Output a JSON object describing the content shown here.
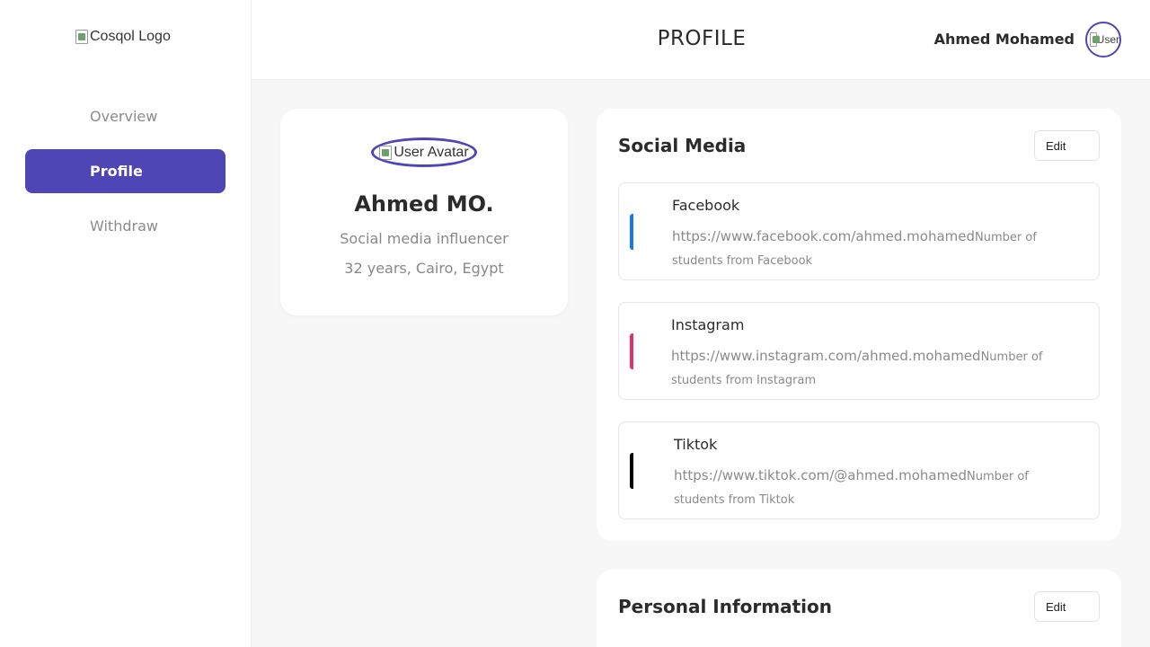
{
  "sidebar": {
    "logo_alt": "Cosqol Logo",
    "items": [
      {
        "label": "Overview",
        "active": false
      },
      {
        "label": "Profile",
        "active": true
      },
      {
        "label": "Withdraw",
        "active": false
      }
    ]
  },
  "header": {
    "title": "PROFILE",
    "user_name": "Ahmed Mohamed",
    "avatar_alt": "User"
  },
  "profile": {
    "avatar_alt": "User Avatar",
    "name": "Ahmed MO.",
    "role": "Social media influencer",
    "meta": "32 years, Cairo, Egypt"
  },
  "social_media": {
    "title": "Social Media",
    "edit_label": "Edit",
    "items": [
      {
        "name": "Facebook",
        "url": "https://www.facebook.com/ahmed.mohamed",
        "sub": "Number of students from Facebook",
        "color": "#1877f2"
      },
      {
        "name": "Instagram",
        "url": "https://www.instagram.com/ahmed.mohamed",
        "sub": "Number of students from Instagram",
        "color": "#e1306c"
      },
      {
        "name": "Tiktok",
        "url": "https://www.tiktok.com/@ahmed.mohamed",
        "sub": "Number of students from Tiktok",
        "color": "#000000"
      }
    ]
  },
  "personal_info": {
    "title": "Personal Information",
    "edit_label": "Edit"
  },
  "colors": {
    "accent": "#4f46b5",
    "background": "#f7f7f7"
  }
}
